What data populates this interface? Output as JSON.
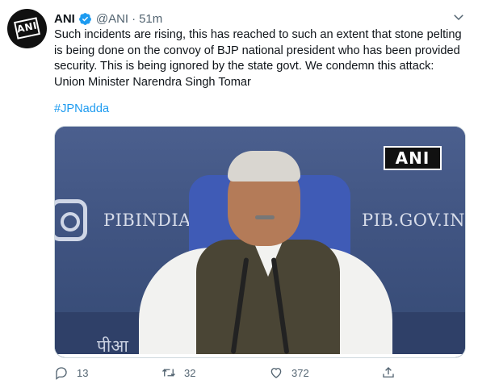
{
  "tweet": {
    "author_name": "ANI",
    "handle": "@ANI",
    "separator": "·",
    "time": "51m",
    "avatar_text": "ANI",
    "text": "Such incidents are rising, this has reached to such an extent that stone pelting is being done on the convoy of BJP national president who has been provided security. This is being ignored by the state govt. We condemn this attack: Union Minister Narendra Singh Tomar",
    "hashtag": "#JPNadda",
    "media": {
      "left_sign": "PIBINDIA",
      "right_sign": "PIB.GOV.IN",
      "hindi_sign": "पीआ",
      "watermark": "ANI"
    },
    "stats": {
      "replies": "13",
      "retweets": "32",
      "likes": "372"
    },
    "icons": [
      "verified-badge-icon",
      "caret-down-icon",
      "reply-icon",
      "retweet-icon",
      "like-icon",
      "share-icon"
    ],
    "colors": {
      "link": "#1d9bf0",
      "verified": "#1d9bf0",
      "muted": "#536471"
    }
  }
}
